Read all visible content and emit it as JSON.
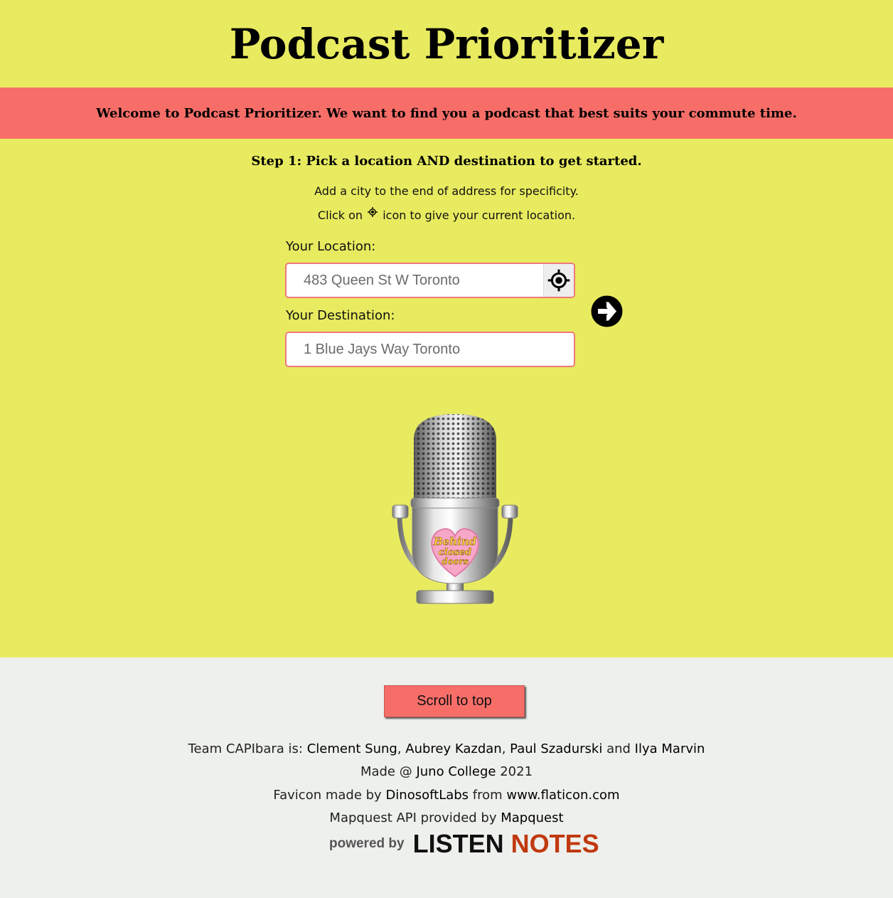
{
  "header": {
    "title": "Podcast Prioritizer"
  },
  "banner": {
    "text": "Welcome to Podcast Prioritizer. We want to find you a podcast that best suits your commute time."
  },
  "step": {
    "heading": "Step 1: Pick a location AND destination to get started.",
    "hint_1": "Add a city to the end of address for specificity.",
    "hint_2_before": "Click on",
    "hint_2_after": "icon to give your current location."
  },
  "form": {
    "location_label": "Your Location:",
    "location_placeholder": "483 Queen St W Toronto",
    "location_value": "",
    "destination_label": "Your Destination:",
    "destination_placeholder": "1 Blue Jays Way Toronto",
    "destination_value": "",
    "locate_icon": "crosshair-icon",
    "submit_icon": "arrow-right-circle-icon"
  },
  "image": {
    "logo_text_1": "Behind",
    "logo_text_2": "closed",
    "logo_text_3": "doors"
  },
  "footer": {
    "scroll_label": "Scroll to top",
    "team_prefix": "Team CAPIbara is:",
    "member_1": "Clement Sung",
    "member_2": "Aubrey Kazdan",
    "member_3": "Paul Szadurski",
    "and_word": "and",
    "member_4": "Ilya Marvin",
    "made_prefix": "Made @",
    "college": "Juno College",
    "year": "2021",
    "favicon_prefix": "Favicon made by",
    "favicon_author": "DinosoftLabs",
    "from_word": "from",
    "flaticon": "www.flaticon.com",
    "mapquest_prefix": "Mapquest API provided by",
    "mapquest": "Mapquest",
    "powered_by": "powered by",
    "listen": "LISTEN",
    "notes": "NOTES"
  },
  "colors": {
    "background": "#e8eb5f",
    "banner": "#f76e69",
    "footer": "#edf0ec",
    "input_border": "#f0787a",
    "notes_accent": "#c1390f"
  }
}
